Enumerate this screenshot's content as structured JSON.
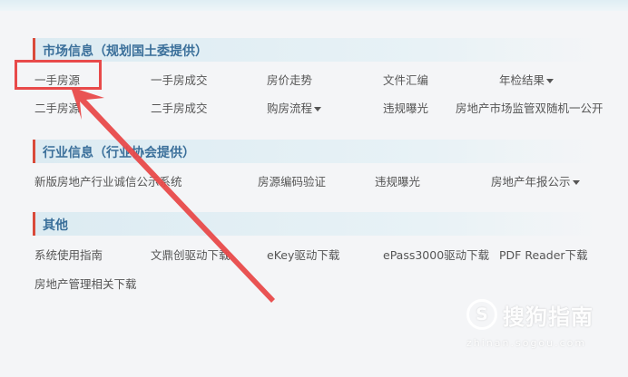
{
  "colors": {
    "accent_bar": "#d94a3a",
    "title": "#3a6f9a",
    "annotation": "#e84a4a"
  },
  "sections": [
    {
      "title": "市场信息（规划国土委提供）",
      "links": [
        "一手房源",
        "一手房成交",
        "房价走势",
        "文件汇编",
        "年检结果",
        "二手房源",
        "二手房成交",
        "购房流程",
        "违规曝光",
        "房地产市场监管双随机一公开"
      ]
    },
    {
      "title": "行业信息（行业协会提供）",
      "links": [
        "新版房地产行业诚信公示系统",
        "房源编码验证",
        "违规曝光",
        "房地产年报公示"
      ]
    },
    {
      "title": "其他",
      "links": [
        "系统使用指南",
        "文鼎创驱动下载",
        "eKey驱动下载",
        "ePass3000驱动下载",
        "PDF Reader下载",
        "房地产管理相关下载"
      ]
    }
  ],
  "annotation": {
    "highlighted_item": "一手房源",
    "arrow_icon": "red-arrow-icon"
  },
  "watermark": {
    "logo_glyph": "S",
    "brand": "搜狗指南",
    "url": "zhinan.sogou.com"
  }
}
